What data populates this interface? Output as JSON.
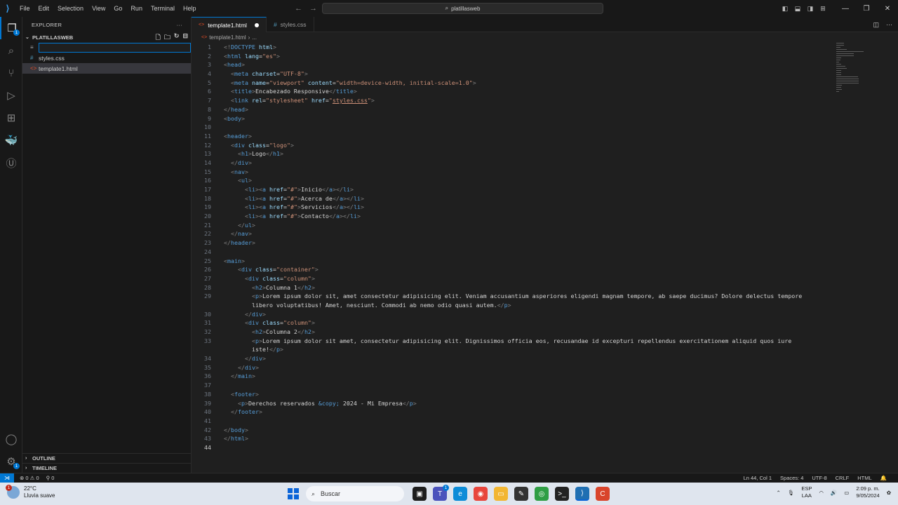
{
  "titlebar": {
    "menu": [
      "File",
      "Edit",
      "Selection",
      "View",
      "Go",
      "Run",
      "Terminal",
      "Help"
    ],
    "command_center": "platillasweb"
  },
  "explorer": {
    "header": "EXPLORER",
    "folder": "PLATILLASWEB",
    "new_file_value": "",
    "files": [
      {
        "name": "styles.css",
        "type": "css"
      },
      {
        "name": "template1.html",
        "type": "html"
      }
    ],
    "outline_label": "OUTLINE",
    "timeline_label": "TIMELINE",
    "accounts_badge": "1"
  },
  "activity": {
    "explorer_badge": "1",
    "settings_badge": "1"
  },
  "tabs": [
    {
      "label": "template1.html",
      "active": true,
      "modified": true
    },
    {
      "label": "styles.css",
      "active": false,
      "modified": false
    }
  ],
  "breadcrumb": {
    "file": "template1.html",
    "rest": "..."
  },
  "code_lines": [
    {
      "n": "1",
      "html": "<span class='t'>&lt;!</span><span class='n'>DOCTYPE</span> <span class='a'>html</span><span class='t'>&gt;</span>"
    },
    {
      "n": "2",
      "html": "<span class='t'>&lt;</span><span class='n'>html</span> <span class='a'>lang</span><span class='p'>=</span><span class='s'>\"es\"</span><span class='t'>&gt;</span>"
    },
    {
      "n": "3",
      "html": "<span class='t'>&lt;</span><span class='n'>head</span><span class='t'>&gt;</span>"
    },
    {
      "n": "4",
      "html": "  <span class='t'>&lt;</span><span class='n'>meta</span> <span class='a'>charset</span><span class='p'>=</span><span class='s'>\"UTF-8\"</span><span class='t'>&gt;</span>"
    },
    {
      "n": "5",
      "html": "  <span class='t'>&lt;</span><span class='n'>meta</span> <span class='a'>name</span><span class='p'>=</span><span class='s'>\"viewport\"</span> <span class='a'>content</span><span class='p'>=</span><span class='s'>\"width=device-width, initial-scale=1.0\"</span><span class='t'>&gt;</span>"
    },
    {
      "n": "6",
      "html": "  <span class='t'>&lt;</span><span class='n'>title</span><span class='t'>&gt;</span><span class='p'>Encabezado Responsive</span><span class='t'>&lt;/</span><span class='n'>title</span><span class='t'>&gt;</span>"
    },
    {
      "n": "7",
      "html": "  <span class='t'>&lt;</span><span class='n'>link</span> <span class='a'>rel</span><span class='p'>=</span><span class='s'>\"stylesheet\"</span> <span class='a'>href</span><span class='p'>=</span><span class='s'>\"<u>styles.css</u>\"</span><span class='t'>&gt;</span>"
    },
    {
      "n": "8",
      "html": "<span class='t'>&lt;/</span><span class='n'>head</span><span class='t'>&gt;</span>"
    },
    {
      "n": "9",
      "html": "<span class='t'>&lt;</span><span class='n'>body</span><span class='t'>&gt;</span>"
    },
    {
      "n": "10",
      "html": ""
    },
    {
      "n": "11",
      "html": "<span class='t'>&lt;</span><span class='n'>header</span><span class='t'>&gt;</span>"
    },
    {
      "n": "12",
      "html": "  <span class='t'>&lt;</span><span class='n'>div</span> <span class='a'>class</span><span class='p'>=</span><span class='s'>\"logo\"</span><span class='t'>&gt;</span>"
    },
    {
      "n": "13",
      "html": "    <span class='t'>&lt;</span><span class='n'>h1</span><span class='t'>&gt;</span><span class='p'>Logo</span><span class='t'>&lt;/</span><span class='n'>h1</span><span class='t'>&gt;</span>"
    },
    {
      "n": "14",
      "html": "  <span class='t'>&lt;/</span><span class='n'>div</span><span class='t'>&gt;</span>"
    },
    {
      "n": "15",
      "html": "  <span class='t'>&lt;</span><span class='n'>nav</span><span class='t'>&gt;</span>"
    },
    {
      "n": "16",
      "html": "    <span class='t'>&lt;</span><span class='n'>ul</span><span class='t'>&gt;</span>"
    },
    {
      "n": "17",
      "html": "      <span class='t'>&lt;</span><span class='n'>li</span><span class='t'>&gt;&lt;</span><span class='n'>a</span> <span class='a'>href</span><span class='p'>=</span><span class='s'>\"#\"</span><span class='t'>&gt;</span><span class='p'>Inicio</span><span class='t'>&lt;/</span><span class='n'>a</span><span class='t'>&gt;&lt;/</span><span class='n'>li</span><span class='t'>&gt;</span>"
    },
    {
      "n": "18",
      "html": "      <span class='t'>&lt;</span><span class='n'>li</span><span class='t'>&gt;&lt;</span><span class='n'>a</span> <span class='a'>href</span><span class='p'>=</span><span class='s'>\"#\"</span><span class='t'>&gt;</span><span class='p'>Acerca de</span><span class='t'>&lt;/</span><span class='n'>a</span><span class='t'>&gt;&lt;/</span><span class='n'>li</span><span class='t'>&gt;</span>"
    },
    {
      "n": "19",
      "html": "      <span class='t'>&lt;</span><span class='n'>li</span><span class='t'>&gt;&lt;</span><span class='n'>a</span> <span class='a'>href</span><span class='p'>=</span><span class='s'>\"#\"</span><span class='t'>&gt;</span><span class='p'>Servicios</span><span class='t'>&lt;/</span><span class='n'>a</span><span class='t'>&gt;&lt;/</span><span class='n'>li</span><span class='t'>&gt;</span>"
    },
    {
      "n": "20",
      "html": "      <span class='t'>&lt;</span><span class='n'>li</span><span class='t'>&gt;&lt;</span><span class='n'>a</span> <span class='a'>href</span><span class='p'>=</span><span class='s'>\"#\"</span><span class='t'>&gt;</span><span class='p'>Contacto</span><span class='t'>&lt;/</span><span class='n'>a</span><span class='t'>&gt;&lt;/</span><span class='n'>li</span><span class='t'>&gt;</span>"
    },
    {
      "n": "21",
      "html": "    <span class='t'>&lt;/</span><span class='n'>ul</span><span class='t'>&gt;</span>"
    },
    {
      "n": "22",
      "html": "  <span class='t'>&lt;/</span><span class='n'>nav</span><span class='t'>&gt;</span>"
    },
    {
      "n": "23",
      "html": "<span class='t'>&lt;/</span><span class='n'>header</span><span class='t'>&gt;</span>"
    },
    {
      "n": "24",
      "html": ""
    },
    {
      "n": "25",
      "html": "<span class='t'>&lt;</span><span class='n'>main</span><span class='t'>&gt;</span>"
    },
    {
      "n": "26",
      "html": "    <span class='t'>&lt;</span><span class='n'>div</span> <span class='a'>class</span><span class='p'>=</span><span class='s'>\"container\"</span><span class='t'>&gt;</span>"
    },
    {
      "n": "27",
      "html": "      <span class='t'>&lt;</span><span class='n'>div</span> <span class='a'>class</span><span class='p'>=</span><span class='s'>\"column\"</span><span class='t'>&gt;</span>"
    },
    {
      "n": "28",
      "html": "        <span class='t'>&lt;</span><span class='n'>h2</span><span class='t'>&gt;</span><span class='p'>Columna 1</span><span class='t'>&lt;/</span><span class='n'>h2</span><span class='t'>&gt;</span>"
    },
    {
      "n": "29",
      "html": "        <span class='t'>&lt;</span><span class='n'>p</span><span class='t'>&gt;</span><span class='p'>Lorem ipsum dolor sit, amet consectetur adipisicing elit. Veniam accusantium asperiores eligendi magnam tempore, ab saepe ducimus? Dolore delectus tempore</span>"
    },
    {
      "n": "",
      "html": "        <span class='p'>libero voluptatibus! Amet, nesciunt. Commodi ab nemo odio quasi autem.</span><span class='t'>&lt;/</span><span class='n'>p</span><span class='t'>&gt;</span>"
    },
    {
      "n": "30",
      "html": "      <span class='t'>&lt;/</span><span class='n'>div</span><span class='t'>&gt;</span>"
    },
    {
      "n": "31",
      "html": "      <span class='t'>&lt;</span><span class='n'>div</span> <span class='a'>class</span><span class='p'>=</span><span class='s'>\"column\"</span><span class='t'>&gt;</span>"
    },
    {
      "n": "32",
      "html": "        <span class='t'>&lt;</span><span class='n'>h2</span><span class='t'>&gt;</span><span class='p'>Columna 2</span><span class='t'>&lt;/</span><span class='n'>h2</span><span class='t'>&gt;</span>"
    },
    {
      "n": "33",
      "html": "        <span class='t'>&lt;</span><span class='n'>p</span><span class='t'>&gt;</span><span class='p'>Lorem ipsum dolor sit amet, consectetur adipisicing elit. Dignissimos officia eos, recusandae id excepturi repellendus exercitationem aliquid quos iure</span>"
    },
    {
      "n": "",
      "html": "        <span class='p'>iste!</span><span class='t'>&lt;/</span><span class='n'>p</span><span class='t'>&gt;</span>"
    },
    {
      "n": "34",
      "html": "      <span class='t'>&lt;/</span><span class='n'>div</span><span class='t'>&gt;</span>"
    },
    {
      "n": "35",
      "html": "    <span class='t'>&lt;/</span><span class='n'>div</span><span class='t'>&gt;</span>"
    },
    {
      "n": "36",
      "html": "  <span class='t'>&lt;/</span><span class='n'>main</span><span class='t'>&gt;</span>"
    },
    {
      "n": "37",
      "html": ""
    },
    {
      "n": "38",
      "html": "  <span class='t'>&lt;</span><span class='n'>footer</span><span class='t'>&gt;</span>"
    },
    {
      "n": "39",
      "html": "    <span class='t'>&lt;</span><span class='n'>p</span><span class='t'>&gt;</span><span class='p'>Derechos reservados </span><span class='e'>&amp;copy;</span><span class='p'> 2024 - Mi Empresa</span><span class='t'>&lt;/</span><span class='n'>p</span><span class='t'>&gt;</span>"
    },
    {
      "n": "40",
      "html": "  <span class='t'>&lt;/</span><span class='n'>footer</span><span class='t'>&gt;</span>"
    },
    {
      "n": "41",
      "html": ""
    },
    {
      "n": "42",
      "html": "<span class='t'>&lt;/</span><span class='n'>body</span><span class='t'>&gt;</span>"
    },
    {
      "n": "43",
      "html": "<span class='t'>&lt;/</span><span class='n'>html</span><span class='t'>&gt;</span>"
    },
    {
      "n": "44",
      "html": ""
    }
  ],
  "current_line": "44",
  "statusbar": {
    "errors": "0",
    "warnings": "0",
    "ports": "0",
    "position": "Ln 44, Col 1",
    "spaces": "Spaces: 4",
    "encoding": "UTF-8",
    "eol": "CRLF",
    "language": "HTML"
  },
  "taskbar": {
    "temperature": "22°C",
    "weather_desc": "Lluvia suave",
    "weather_badge": "1",
    "search_placeholder": "Buscar",
    "teams_badge": "1",
    "lang_top": "ESP",
    "lang_bottom": "LAA",
    "time": "2:09 p. m.",
    "date": "9/05/2024"
  },
  "colors": {
    "accent": "#0078d4",
    "background": "#1f1f1f",
    "sidebar": "#181818"
  }
}
